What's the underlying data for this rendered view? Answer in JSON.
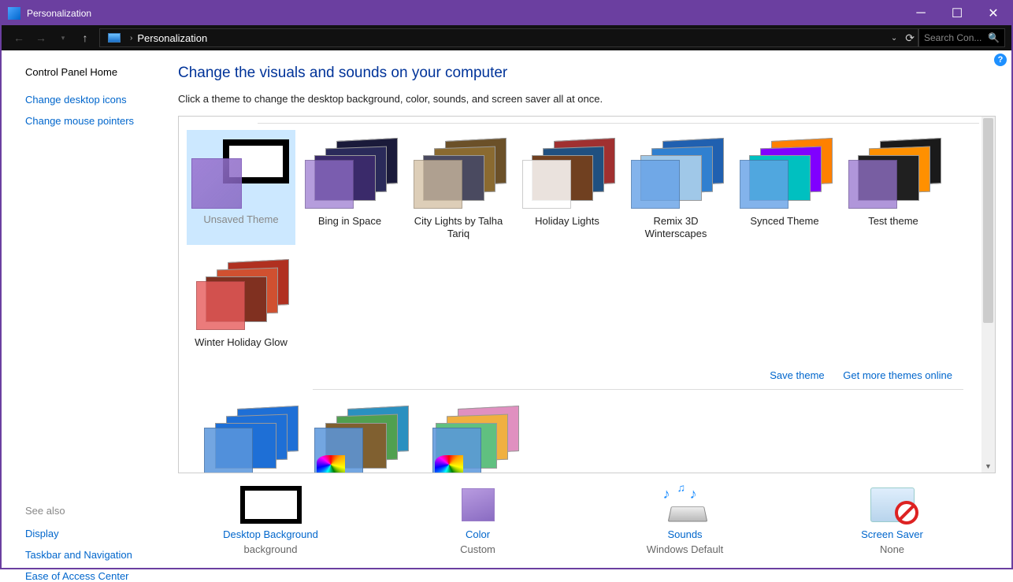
{
  "window": {
    "title": "Personalization"
  },
  "breadcrumb": {
    "current": "Personalization"
  },
  "search": {
    "placeholder": "Search Con..."
  },
  "sidebar": {
    "home": "Control Panel Home",
    "links": [
      "Change desktop icons",
      "Change mouse pointers"
    ],
    "see_also_header": "See also",
    "see_also": [
      "Display",
      "Taskbar and Navigation",
      "Ease of Access Center"
    ]
  },
  "heading": "Change the visuals and sounds on your computer",
  "subtitle": "Click a theme to change the desktop background, color, sounds, and screen saver all at once.",
  "themes": [
    {
      "label": "Unsaved Theme",
      "swatch": "rgba(150,115,205,.85)",
      "selected": true
    },
    {
      "label": "Bing in Space",
      "swatch": "rgba(150,115,205,.7)",
      "bg": [
        "#1a1a3a",
        "#2a2a5a",
        "#3a2a6a"
      ]
    },
    {
      "label": "City Lights by Talha Tariq",
      "swatch": "rgba(210,190,160,.75)",
      "bg": [
        "#6b5028",
        "#8a6a30",
        "#4a4a60"
      ]
    },
    {
      "label": "Holiday Lights",
      "swatch": "rgba(255,255,255,.85)",
      "bg": [
        "#a03030",
        "#205080",
        "#704020"
      ]
    },
    {
      "label": "Remix 3D Winterscapes",
      "swatch": "rgba(100,160,230,.8)",
      "bg": [
        "#2060b0",
        "#3080d0",
        "#a0c8e8"
      ]
    },
    {
      "label": "Synced Theme",
      "swatch": "rgba(100,160,230,.8)",
      "bg": [
        "#ff8000",
        "#8000ff",
        "#00c0c0"
      ]
    },
    {
      "label": "Test theme",
      "swatch": "rgba(150,115,205,.75)",
      "bg": [
        "#1a1a1a",
        "#ff9000",
        "#202020"
      ]
    },
    {
      "label": "Winter Holiday Glow",
      "swatch": "rgba(230,90,90,.8)",
      "bg": [
        "#b03020",
        "#d05030",
        "#803020"
      ]
    }
  ],
  "theme_links": {
    "save": "Save theme",
    "more": "Get more themes online"
  },
  "row2": [
    {
      "swatch": "rgba(90,150,220,.85)",
      "bg": [
        "#1e6fd6",
        "#1e6fd6",
        "#1e6fd6"
      ]
    },
    {
      "swatch": "rgba(90,150,220,.85)",
      "bg": [
        "#2a90c0",
        "#50a050",
        "#806030"
      ],
      "palette": true
    },
    {
      "swatch": "rgba(90,150,220,.85)",
      "bg": [
        "#e090c0",
        "#f0b040",
        "#60c080"
      ],
      "palette": true,
      "shift": true
    }
  ],
  "settings": [
    {
      "name": "Desktop Background",
      "value": "background",
      "icon": "bg"
    },
    {
      "name": "Color",
      "value": "Custom",
      "icon": "color"
    },
    {
      "name": "Sounds",
      "value": "Windows Default",
      "icon": "sounds"
    },
    {
      "name": "Screen Saver",
      "value": "None",
      "icon": "ss"
    }
  ]
}
